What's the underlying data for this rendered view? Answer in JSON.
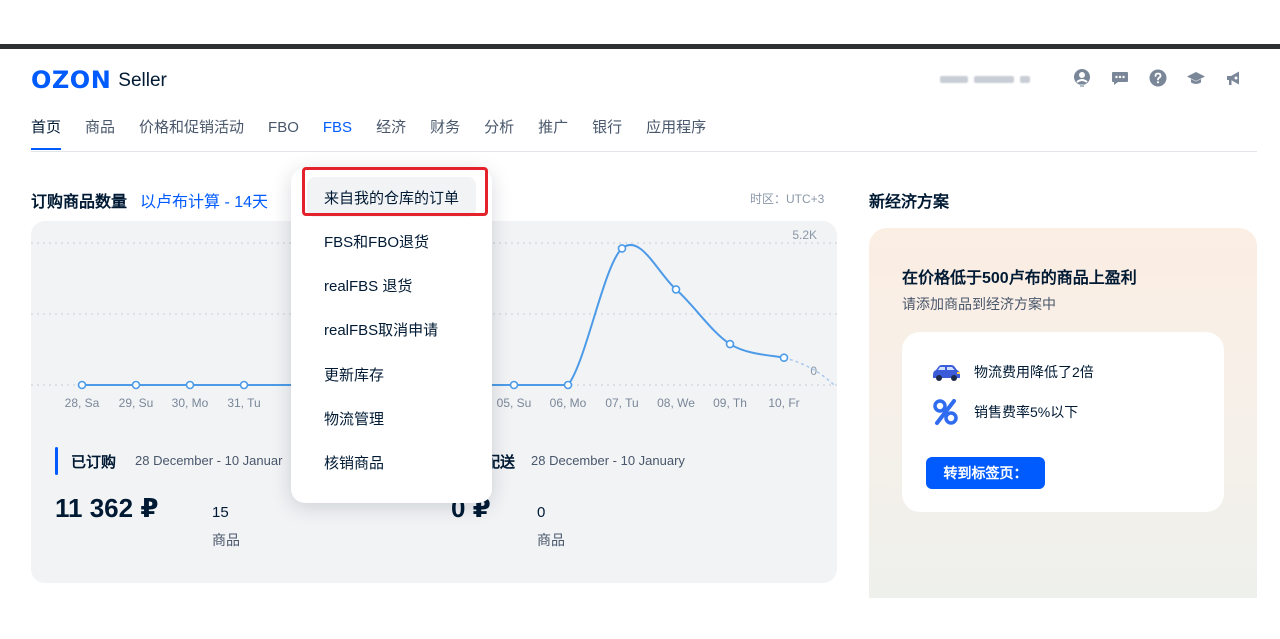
{
  "header": {
    "logo_brand": "OZON",
    "logo_product": "Seller",
    "icons": [
      "user-circle-icon",
      "chat-icon",
      "help-icon",
      "graduation-cap-icon",
      "megaphone-icon"
    ]
  },
  "nav": {
    "items": [
      {
        "label": "首页",
        "active": true
      },
      {
        "label": "商品"
      },
      {
        "label": "价格和促销活动"
      },
      {
        "label": "FBO"
      },
      {
        "label": "FBS",
        "open": true
      },
      {
        "label": "经济"
      },
      {
        "label": "财务"
      },
      {
        "label": "分析"
      },
      {
        "label": "推广"
      },
      {
        "label": "银行"
      },
      {
        "label": "应用程序"
      }
    ]
  },
  "orders_section": {
    "title": "订购商品数量",
    "subtitle": "以卢布计算 - 14天",
    "timezone": "时区：UTC+3"
  },
  "chart_data": {
    "type": "line",
    "x": [
      "28, Sa",
      "29, Su",
      "30, Mo",
      "31, Tu",
      "01",
      "02",
      "03",
      "04",
      "05, Su",
      "06, Mo",
      "07, Tu",
      "08, We",
      "09, Th",
      "10, Fr"
    ],
    "visible_x_labels": [
      "28, Sa",
      "29, Su",
      "30, Mo",
      "31, Tu",
      "01",
      "05, Su",
      "06, Mo",
      "07, Tu",
      "08, We",
      "09, Th",
      "10, Fr"
    ],
    "series": [
      {
        "values": [
          0,
          0,
          0,
          0,
          0,
          0,
          0,
          0,
          0,
          0,
          5000,
          3500,
          1500,
          1000
        ],
        "color": "#4d9be8"
      }
    ],
    "y_tick_labels": [
      "5.2K",
      "0"
    ],
    "ylim": [
      0,
      5200
    ],
    "grid": true
  },
  "stats": {
    "ordered": {
      "label": "已订购",
      "range": "28 December - 10 Januar",
      "value": "11 362 ₽",
      "count": "15",
      "unit": "商品"
    },
    "delivered": {
      "label": "配送",
      "range": "28 December - 10 January",
      "value": "0 ₽",
      "count": "0",
      "unit": "商品"
    }
  },
  "promo": {
    "heading": "新经济方案",
    "title": "在价格低于500卢布的商品上盈利",
    "subtitle": "请添加商品到经济方案中",
    "features": [
      {
        "icon": "car-icon",
        "text": "物流费用降低了2倍"
      },
      {
        "icon": "percent-icon",
        "text": "销售费率5%以下"
      }
    ],
    "button_label": "转到标签页："
  },
  "dropdown": {
    "items": [
      "来自我的仓库的订单",
      "FBS和FBO退货",
      "realFBS 退货",
      "realFBS取消申请",
      "更新库存",
      "物流管理",
      "核销商品"
    ],
    "highlighted_index": 0,
    "annotation_color": "#e4222c"
  },
  "colors": {
    "brand": "#005bff",
    "text": "#001a34",
    "muted": "#49576b"
  }
}
